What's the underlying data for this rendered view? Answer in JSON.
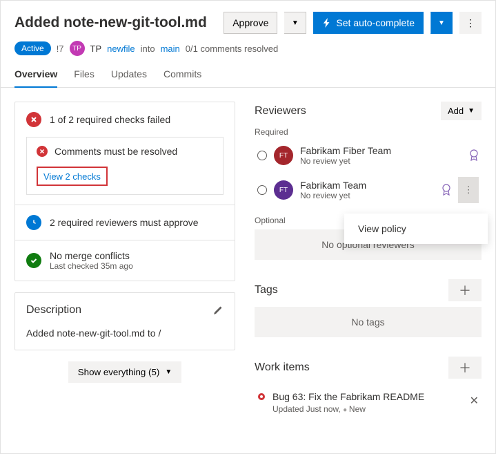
{
  "header": {
    "title": "Added note-new-git-tool.md",
    "approve": "Approve",
    "setAutoComplete": "Set auto-complete",
    "status": "Active",
    "prNumber": "!7",
    "avatarInitials": "TP",
    "author": "TP",
    "sourceBranch": "newfile",
    "into": "into",
    "targetBranch": "main",
    "commentsResolved": "0/1 comments resolved"
  },
  "tabs": [
    "Overview",
    "Files",
    "Updates",
    "Commits"
  ],
  "checks": {
    "summary": "1 of 2 required checks failed",
    "commentCheck": "Comments must be resolved",
    "viewChecks": "View 2 checks",
    "reviewers": "2 required reviewers must approve",
    "mergeTitle": "No merge conflicts",
    "mergeSub": "Last checked 35m ago"
  },
  "description": {
    "title": "Description",
    "text": "Added note-new-git-tool.md to /"
  },
  "showEverything": "Show everything (5)",
  "reviewersSection": {
    "title": "Reviewers",
    "add": "Add",
    "required": "Required",
    "optional": "Optional",
    "noOptional": "No optional reviewers",
    "list": [
      {
        "initials": "FT",
        "name": "Fabrikam Fiber Team",
        "sub": "No review yet"
      },
      {
        "initials": "FT",
        "name": "Fabrikam Team",
        "sub": "No review yet"
      }
    ]
  },
  "popover": {
    "viewPolicy": "View policy"
  },
  "tagsSection": {
    "title": "Tags",
    "noTags": "No tags"
  },
  "workItemsSection": {
    "title": "Work items",
    "itemTitle": "Bug 63: Fix the Fabrikam README",
    "itemSub1": "Updated Just now,",
    "itemSub2": "New"
  }
}
